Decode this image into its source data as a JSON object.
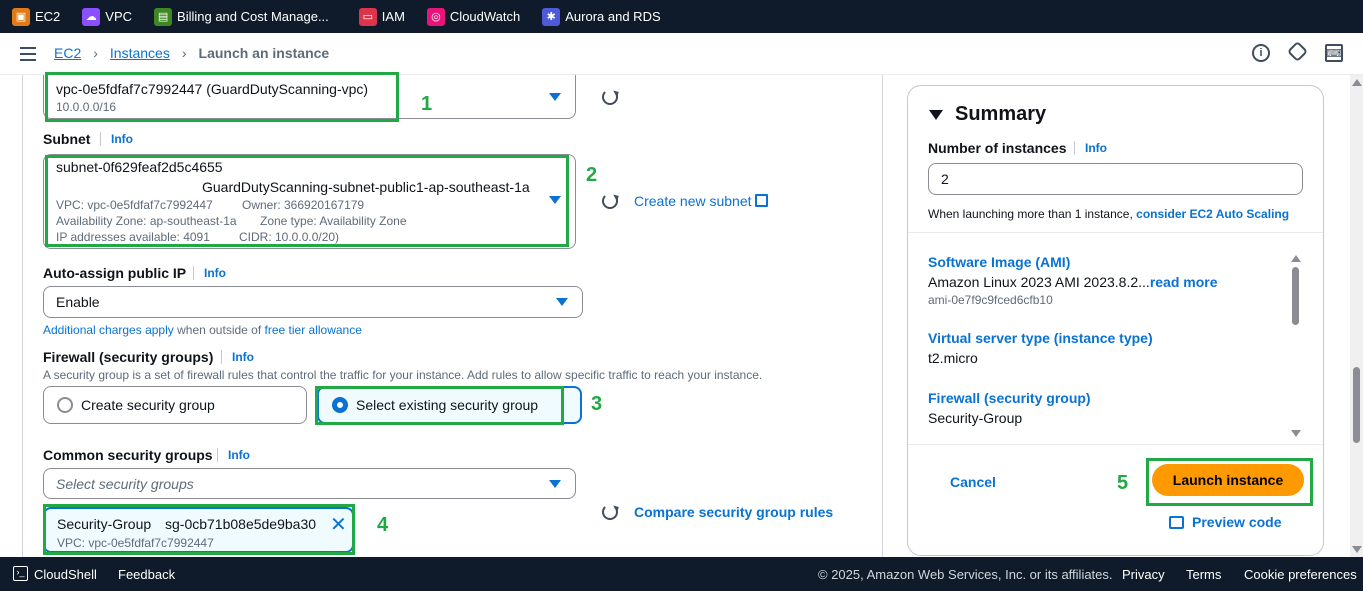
{
  "favorites": [
    {
      "label": "EC2",
      "icon": "ec2-icon",
      "color": "#e07b1a"
    },
    {
      "label": "VPC",
      "icon": "vpc-icon",
      "color": "#8a4fff"
    },
    {
      "label": "Billing and Cost Manage...",
      "icon": "billing-icon",
      "color": "#3f8624"
    },
    {
      "label": "IAM",
      "icon": "iam-icon",
      "color": "#dd344c"
    },
    {
      "label": "CloudWatch",
      "icon": "cloudwatch-icon",
      "color": "#e7157b"
    },
    {
      "label": "Aurora and RDS",
      "icon": "rds-icon",
      "color": "#4d5bd9"
    }
  ],
  "breadcrumb": {
    "root": "EC2",
    "section": "Instances",
    "current": "Launch an instance"
  },
  "vpc": {
    "value": "vpc-0e5fdfaf7c7992447 (GuardDutyScanning-vpc)",
    "cidr": "10.0.0.0/16"
  },
  "subnet": {
    "label": "Subnet",
    "info": "Info",
    "id": "subnet-0f629feaf2d5c4655",
    "name": "GuardDutyScanning-subnet-public1-ap-southeast-1a",
    "vpc_line": "VPC: vpc-0e5fdfaf7c7992447",
    "owner_line": "Owner: 366920167179",
    "az_line": "Availability Zone: ap-southeast-1a",
    "zone_type_line": "Zone type: Availability Zone",
    "ip_line": "IP addresses available: 4091",
    "cidr_line": "CIDR: 10.0.0.0/20)",
    "create_link": "Create new subnet"
  },
  "public_ip": {
    "label": "Auto-assign public IP",
    "info": "Info",
    "value": "Enable",
    "charges_link": "Additional charges apply",
    "charges_text": "when outside of",
    "free_tier_link": "free tier allowance"
  },
  "firewall": {
    "label": "Firewall (security groups)",
    "info": "Info",
    "description": "A security group is a set of firewall rules that control the traffic for your instance. Add rules to allow specific traffic to reach your instance.",
    "option_create": "Create security group",
    "option_select": "Select existing security group"
  },
  "common_sg": {
    "label": "Common security groups",
    "info": "Info",
    "placeholder": "Select security groups",
    "compare_link": "Compare security group rules",
    "token_name": "Security-Group",
    "token_id": "sg-0cb71b08e5de9ba30",
    "token_vpc": "VPC: vpc-0e5fdfaf7c7992447"
  },
  "annotations": [
    "1",
    "2",
    "3",
    "4",
    "5"
  ],
  "summary": {
    "title": "Summary",
    "instances_label": "Number of instances",
    "info": "Info",
    "instances_value": "2",
    "hint_text": "When launching more than 1 instance,",
    "hint_link": "consider EC2 Auto Scaling",
    "ami_heading": "Software Image (AMI)",
    "ami_value": "Amazon Linux 2023 AMI 2023.8.2...",
    "ami_more": "read more",
    "ami_id": "ami-0e7f9c9fced6cfb10",
    "type_heading": "Virtual server type (instance type)",
    "type_value": "t2.micro",
    "fw_heading": "Firewall (security group)",
    "fw_value": "Security-Group",
    "cancel": "Cancel",
    "launch": "Launch instance",
    "preview": "Preview code"
  },
  "footer": {
    "cloudshell": "CloudShell",
    "feedback": "Feedback",
    "copyright": "© 2025, Amazon Web Services, Inc. or its affiliates.",
    "privacy": "Privacy",
    "terms": "Terms",
    "cookies": "Cookie preferences"
  }
}
